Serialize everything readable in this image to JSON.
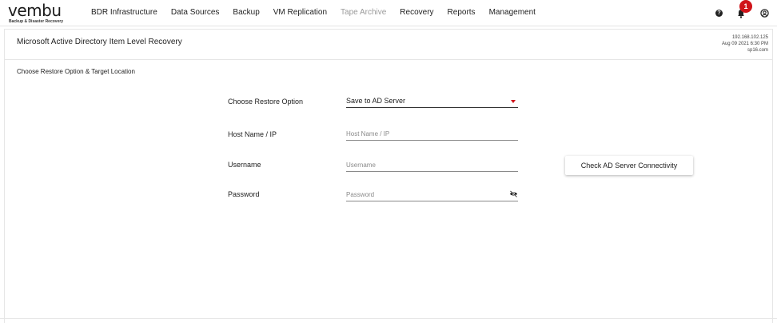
{
  "logo": {
    "word": "vembu",
    "tagline": "Backup & Disaster Recovery"
  },
  "nav": {
    "items": [
      {
        "label": "BDR Infrastructure",
        "enabled": true
      },
      {
        "label": "Data Sources",
        "enabled": true
      },
      {
        "label": "Backup",
        "enabled": true
      },
      {
        "label": "VM Replication",
        "enabled": true
      },
      {
        "label": "Tape Archive",
        "enabled": false
      },
      {
        "label": "Recovery",
        "enabled": true
      },
      {
        "label": "Reports",
        "enabled": true
      },
      {
        "label": "Management",
        "enabled": true
      }
    ]
  },
  "header_icons": {
    "help": "?",
    "notifications_count": "1",
    "names": [
      "help-icon",
      "bell-icon",
      "user-icon"
    ]
  },
  "page": {
    "title": "Microsoft Active Directory Item Level Recovery",
    "server_ip": "192.168.102.125",
    "server_datetime": "Aug 09 2021 6:30 PM",
    "server_name": "sp16.com"
  },
  "section": {
    "title": "Choose Restore Option & Target Location"
  },
  "form": {
    "restore_option": {
      "label": "Choose Restore Option",
      "value": "Save to AD Server"
    },
    "host": {
      "label": "Host Name / IP",
      "placeholder": "Host Name / IP"
    },
    "username": {
      "label": "Username",
      "placeholder": "Username"
    },
    "password": {
      "label": "Password",
      "placeholder": "Password"
    }
  },
  "actions": {
    "check_connectivity": "Check AD Server Connectivity"
  },
  "colors": {
    "accent": "#d0141a",
    "border": "#e6e6e6",
    "disabled_text": "#9a9a9a"
  }
}
